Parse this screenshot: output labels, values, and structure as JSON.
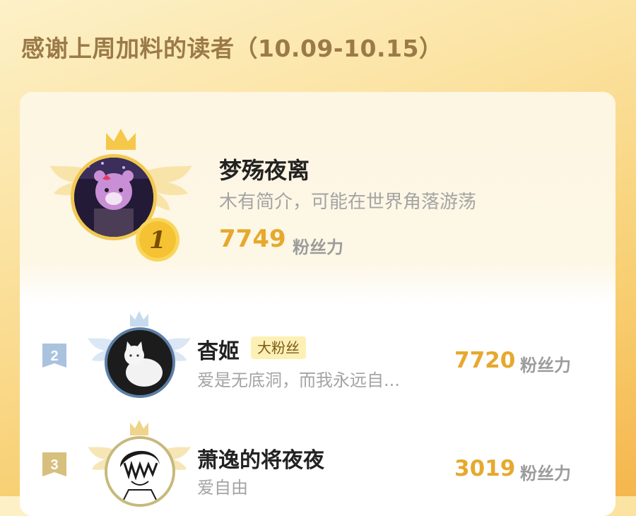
{
  "header": {
    "title": "感谢上周加料的读者（10.09-10.15）"
  },
  "top_reader": {
    "rank": "1",
    "name": "梦殇夜离",
    "bio": "木有简介，可能在世界角落游荡",
    "score": "7749",
    "score_unit": "粉丝力"
  },
  "readers": [
    {
      "rank": "2",
      "name": "杳姬",
      "tag": "大粉丝",
      "bio": "爱是无底洞，而我永远自...",
      "score": "7720",
      "score_unit": "粉丝力"
    },
    {
      "rank": "3",
      "name": "萧逸的将夜夜",
      "bio": "爱自由",
      "score": "3019",
      "score_unit": "粉丝力"
    }
  ],
  "colors": {
    "accent": "#e6a92d",
    "heading": "#9b7a48",
    "gold_badge": "#f4c233",
    "silver_badge": "#a9c3df",
    "bronze_badge": "#d7bf7d"
  }
}
